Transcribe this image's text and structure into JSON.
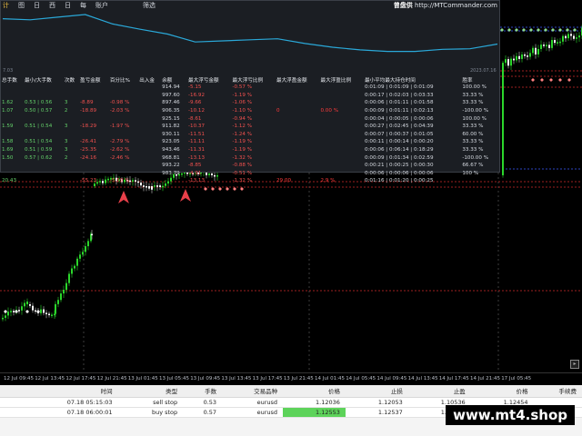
{
  "colors": {
    "bull_candle": "#2bd62b",
    "bear_candle": "#ffffff",
    "equity_line": "#2aa8d8",
    "level_red": "#d12a2a",
    "level_blue": "#3d5cff",
    "arrow": "#e8404a",
    "order_highlight": "#5dd35a",
    "accent_gold": "#f0c040"
  },
  "overlay": {
    "tabs": [
      "计",
      "图",
      "日",
      "西",
      "日",
      "每",
      "账户"
    ],
    "filter_label": "筛选",
    "brand_prefix": "曾盘供",
    "brand_site": "http://MTCommander.com",
    "equity_start_label": "7.03",
    "equity_end_label": "2023.07.16",
    "equity_curve": [
      0.92,
      0.9,
      0.95,
      1.0,
      0.82,
      0.72,
      0.63,
      0.48,
      0.5,
      0.52,
      0.54,
      0.45,
      0.38,
      0.33,
      0.3,
      0.3,
      0.34,
      0.35,
      0.44
    ]
  },
  "stats": {
    "headers": [
      "总手数",
      "最小/大手数",
      "次数",
      "盈亏金额",
      "百分比%",
      "出入金",
      "余额",
      "最大浮亏金额",
      "最大浮亏比例",
      "最大浮盈金额",
      "最大浮盈比例",
      "最小平均最大持仓时间",
      "胜率"
    ],
    "rows": [
      {
        "cells": [
          "",
          "",
          "",
          "",
          "",
          "",
          "914.94",
          "-5.15",
          "-0.57 %",
          "",
          "",
          "0:01:09 | 0:01:09 | 0:01:09",
          "100.00 %"
        ],
        "pnl_sign": "neg"
      },
      {
        "cells": [
          "",
          "",
          "",
          "",
          "",
          "",
          "997.60",
          "-16.92",
          "-1.19 %",
          "",
          "",
          "0:00:17 | 0:02:03 | 0:03:33",
          "33.33 %"
        ],
        "pnl_sign": "neg"
      },
      {
        "cells": [
          "1.62",
          "0.53 | 0.56",
          "3",
          "-8.89",
          "-0.98 %",
          "",
          "897.46",
          "-9.66",
          "-1.06 %",
          "",
          "",
          "0:00:06 | 0:01:11 | 0:01:58",
          "33.33 %"
        ],
        "pnl_sign": "neg"
      },
      {
        "cells": [
          "1.07",
          "0.50 | 0.57",
          "2",
          "-18.89",
          "-2.03 %",
          "",
          "906.35",
          "-10.12",
          "-1.10 %",
          "0",
          "0.00 %",
          "0:00:09 | 0:01:11 | 0:02:13",
          "-100.00 %"
        ],
        "pnl_sign": "neg"
      },
      {
        "cells": [
          "",
          "",
          "",
          "",
          "",
          "",
          "925.15",
          "-8.61",
          "-0.94 %",
          "",
          "",
          "0:00:04 | 0:00:05 | 0:00:06",
          "100.00 %"
        ],
        "pnl_sign": "neg"
      },
      {
        "cells": [
          "1.59",
          "0.51 | 0.54",
          "3",
          "-18.29",
          "-1.97 %",
          "",
          "911.82",
          "-10.37",
          "-1.12 %",
          "",
          "",
          "0:00:27 | 0:02:45 | 0:04:39",
          "33.33 %"
        ],
        "pnl_sign": "neg"
      },
      {
        "cells": [
          "",
          "",
          "",
          "",
          "",
          "",
          "930.11",
          "-11.51",
          "-1.24 %",
          "",
          "",
          "0:00:07 | 0:00:37 | 0:01:05",
          "60.00 %"
        ],
        "pnl_sign": "neg"
      },
      {
        "cells": [
          "1.58",
          "0.51 | 0.54",
          "3",
          "-26.41",
          "-2.79 %",
          "",
          "923.05",
          "-11.11",
          "-1.19 %",
          "",
          "",
          "0:00:11 | 0:00:14 | 0:00:20",
          "33.33 %"
        ],
        "pnl_sign": "neg"
      },
      {
        "cells": [
          "1.69",
          "0.51 | 0.59",
          "3",
          "-25.35",
          "-2.62 %",
          "",
          "943.46",
          "-11.31",
          "-1.19 %",
          "",
          "",
          "0:00:06 | 0:06:14 | 0:18:29",
          "33.33 %"
        ],
        "pnl_sign": "neg"
      },
      {
        "cells": [
          "1.50",
          "0.57 | 0.62",
          "2",
          "-24.16",
          "-2.46 %",
          "",
          "968.81",
          "-13.13",
          "-1.32 %",
          "",
          "",
          "0:00:09 | 0:01:34 | 0:02:59",
          "-100.00 %"
        ],
        "pnl_sign": "neg"
      },
      {
        "cells": [
          "",
          "",
          "",
          "",
          "",
          "",
          "993.22",
          "-8.85",
          "-0.88 %",
          "",
          "",
          "0:00:21 | 0:00:25 | 0:00:30",
          "66.67 %"
        ],
        "pnl_sign": "neg"
      },
      {
        "cells": [
          "",
          "",
          "",
          "",
          "",
          "",
          "983.79",
          "-4.91",
          "-0.51 %",
          "",
          "",
          "0:00:06 | 0:00:06 | 0:00:06",
          "100 %"
        ],
        "pnl_sign": "neg"
      },
      {
        "cells": [
          "20.43",
          "",
          "",
          "-55.23",
          "-5.69 %",
          "",
          "",
          "-13.13",
          "-1.32 %",
          "29.00",
          "2.9 %",
          "0:01:16 | 0:01:20 | 0:00:25",
          ""
        ],
        "pnl_sign": "neg"
      }
    ]
  },
  "time_axis": [
    "12 Jul 09:45",
    "12 Jul 13:45",
    "12 Jul 17:45",
    "12 Jul 21:45",
    "13 Jul 01:45",
    "13 Jul 05:45",
    "13 Jul 09:45",
    "13 Jul 13:45",
    "13 Jul 17:45",
    "13 Jul 21:45",
    "14 Jul 01:45",
    "14 Jul 05:45",
    "14 Jul 09:45",
    "14 Jul 13:45",
    "14 Jul 17:45",
    "14 Jul 21:45",
    "17 Jul 05:45"
  ],
  "orders": {
    "headers": [
      "",
      "时间",
      "类型",
      "手数",
      "交易品种",
      "价格",
      "止损",
      "止盈",
      "价格",
      "手续费"
    ],
    "rows": [
      {
        "time": "07.18 05:15:03",
        "type": "sell stop",
        "lots": "0.53",
        "symbol": "eurusd",
        "price": "1.12036",
        "sl": "1.12053",
        "tp": "1.10536",
        "cur": "1.12454",
        "fee": "",
        "highlight": false
      },
      {
        "time": "07.18 06:00:01",
        "type": "buy stop",
        "lots": "0.57",
        "symbol": "eurusd",
        "price": "1.12553",
        "sl": "1.12537",
        "tp": "1.14053",
        "cur": "1.12454",
        "fee": "",
        "highlight": true
      }
    ]
  },
  "watermark": "www.mt4.shop"
}
